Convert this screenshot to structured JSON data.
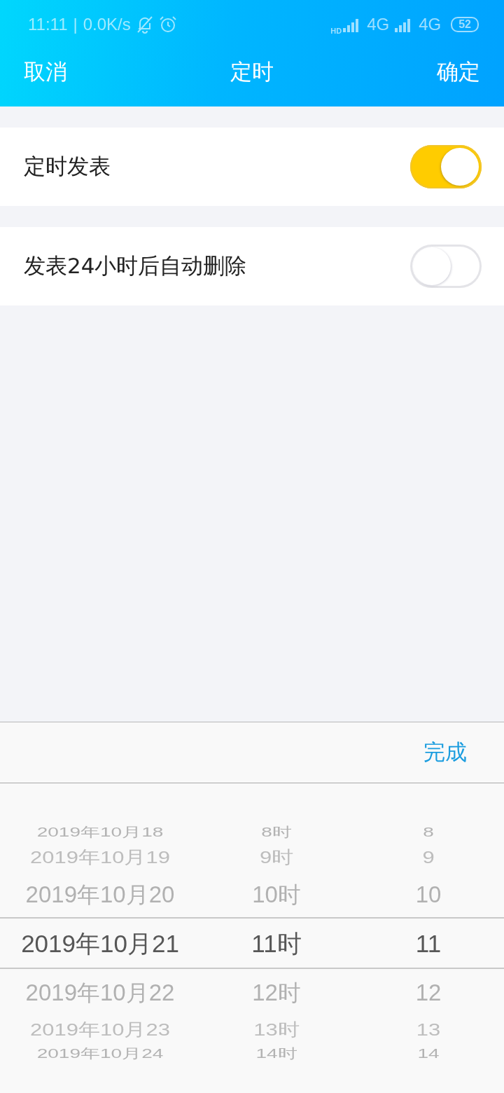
{
  "status_bar": {
    "time": "11:11",
    "separator": "|",
    "speed": "0.0K/s",
    "hd": "HD",
    "network_1": "4G",
    "network_2": "4G",
    "battery": "52"
  },
  "nav": {
    "cancel": "取消",
    "title": "定时",
    "confirm": "确定"
  },
  "settings": [
    {
      "label": "定时发表",
      "on": true
    },
    {
      "label": "发表24小时后自动删除",
      "on": false
    }
  ],
  "picker": {
    "done": "完成",
    "columns": [
      {
        "items": [
          {
            "label": "2019年10月18",
            "selected": false
          },
          {
            "label": "2019年10月19",
            "selected": false
          },
          {
            "label": "2019年10月20",
            "selected": false
          },
          {
            "label": "2019年10月21",
            "selected": true
          },
          {
            "label": "2019年10月22",
            "selected": false
          },
          {
            "label": "2019年10月23",
            "selected": false
          },
          {
            "label": "2019年10月24",
            "selected": false
          }
        ]
      },
      {
        "items": [
          {
            "label": "8时",
            "selected": false
          },
          {
            "label": "9时",
            "selected": false
          },
          {
            "label": "10时",
            "selected": false
          },
          {
            "label": "11时",
            "selected": true
          },
          {
            "label": "12时",
            "selected": false
          },
          {
            "label": "13时",
            "selected": false
          },
          {
            "label": "14时",
            "selected": false
          }
        ]
      },
      {
        "items": [
          {
            "label": "8",
            "selected": false
          },
          {
            "label": "9",
            "selected": false
          },
          {
            "label": "10",
            "selected": false
          },
          {
            "label": "11",
            "selected": true
          },
          {
            "label": "12",
            "selected": false
          },
          {
            "label": "13",
            "selected": false
          },
          {
            "label": "14",
            "selected": false
          }
        ]
      }
    ]
  }
}
